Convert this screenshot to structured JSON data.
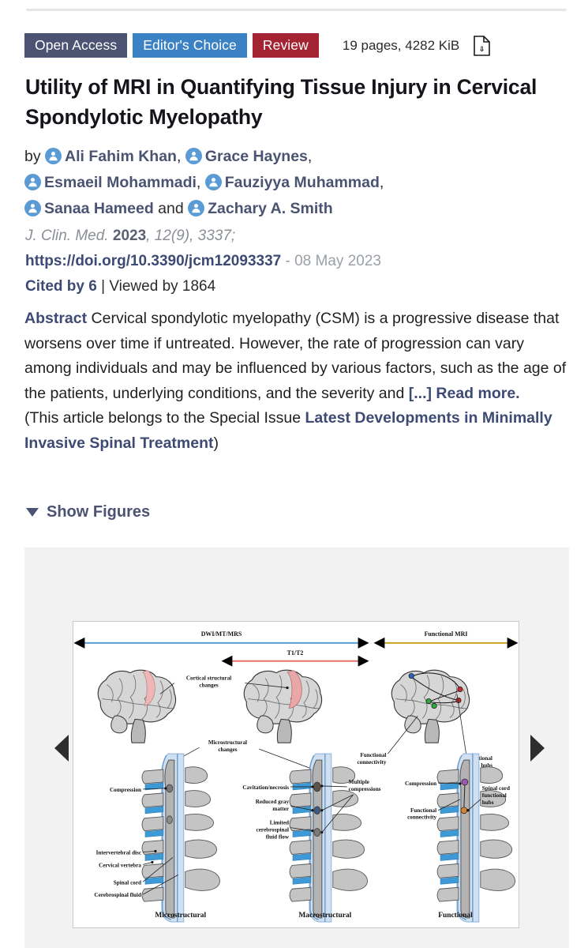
{
  "badges": [
    {
      "label": "Open Access",
      "color": "#4b5272",
      "name": "open-access-badge"
    },
    {
      "label": "Editor's Choice",
      "color": "#3b82c4",
      "name": "editors-choice-badge"
    },
    {
      "label": "Review",
      "color": "#a32333",
      "name": "review-badge"
    }
  ],
  "pages_info": "19 pages, 4282 KiB",
  "pdf_icon": "pdf-file-icon",
  "title": "Utility of MRI in Quantifying Tissue Injury in Cervical Spondylotic Myelopathy",
  "authors": {
    "by_label": "by",
    "and_label": "and",
    "list": [
      "Ali Fahim Khan",
      "Grace Haynes",
      "Esmaeil Mohammadi",
      "Fauziyya Muhammad",
      "Sanaa Hameed",
      "Zachary A. Smith"
    ]
  },
  "citation": {
    "journal": "J. Clin. Med.",
    "year": "2023",
    "volume_issue": "12(9)",
    "article_number": "3337;",
    "doi": "https://doi.org/10.3390/jcm12093337",
    "dash_date": "- 08 May 2023",
    "cited_by": "Cited by 6",
    "divider": "|",
    "viewed_by": "Viewed by 1864"
  },
  "abstract": {
    "label": "Abstract",
    "body": "Cervical spondylotic myelopathy (CSM) is a progressive disease that worsens over time if untreated. However, the rate of progression can vary among individuals and may be influenced by various factors, such as the age of the patients, underlying conditions, and the severity and ",
    "read_more": "[...] Read more.",
    "special_issue_prefix": "(This article belongs to the Special Issue ",
    "special_issue_title": "Latest Developments in Minimally Invasive Spinal Treatment",
    "special_issue_suffix": ")"
  },
  "show_figures": {
    "label": "Show Figures",
    "chevron": "triangle-down-icon"
  },
  "carousel": {
    "prev": "previous-figure-arrow",
    "next": "next-figure-arrow"
  },
  "figure": {
    "top_arrows": [
      {
        "label": "DWI/MT/MRS",
        "color": "#5b9bd5"
      },
      {
        "label": "T1/T2",
        "color": "#e8716b"
      },
      {
        "label": "Functional MRI",
        "color": "#c9a227"
      }
    ],
    "brain_labels": [
      "Cortical structural\nchanges",
      "Functional\nconnectivity",
      "Functional\nbrain hubs",
      "Microstructural\nchanges"
    ],
    "spine_labels_left": [
      "Compression",
      "Intervertebral disc",
      "Cervical vertebra",
      "Spinal cord",
      "Cerebrospinal fluid"
    ],
    "spine_labels_middle": [
      "Cavitation/necrosis",
      "Reduced gray",
      "matter",
      "Limited",
      "cerebrospinal",
      "fluid flow",
      "Multiple",
      "compressions"
    ],
    "spine_labels_right": [
      "Compression",
      "Functional",
      "connectivity",
      "Spinal cord",
      "functional",
      "hubs"
    ],
    "column_captions": [
      "Microstructural",
      "Macrostructural",
      "Functional"
    ]
  }
}
